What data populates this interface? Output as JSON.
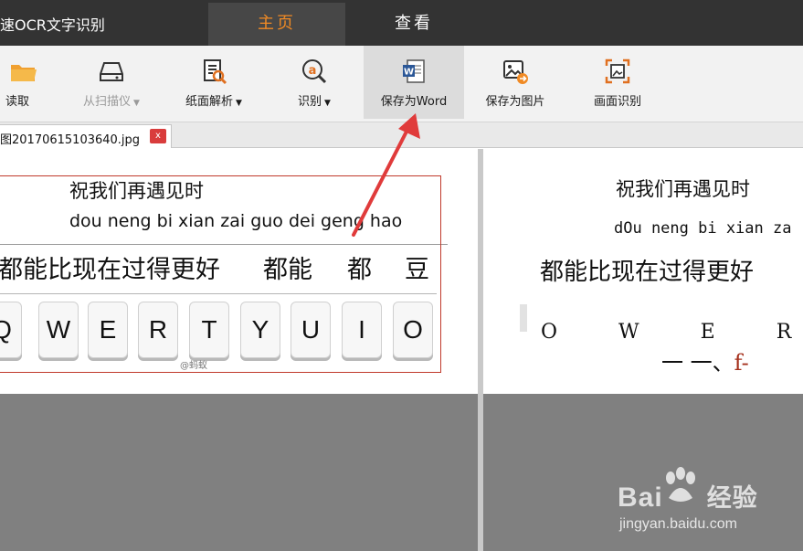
{
  "window": {
    "title": "速OCR文字识别"
  },
  "top_tabs": [
    {
      "label": "主页",
      "active": true
    },
    {
      "label": "查看",
      "active": false
    }
  ],
  "toolbar": {
    "items": [
      {
        "label": "读取",
        "icon": "folder-icon",
        "dropdown": false,
        "disabled": false
      },
      {
        "label": "从扫描仪",
        "icon": "scanner-icon",
        "dropdown": true,
        "disabled": true
      },
      {
        "label": "纸面解析",
        "icon": "page-analysis-icon",
        "dropdown": true,
        "disabled": false
      },
      {
        "label": "识别",
        "icon": "recognize-icon",
        "dropdown": true,
        "disabled": false
      },
      {
        "label": "保存为Word",
        "icon": "word-icon",
        "dropdown": false,
        "disabled": false,
        "highlighted": true
      },
      {
        "label": "保存为图片",
        "icon": "save-image-icon",
        "dropdown": false,
        "disabled": false
      },
      {
        "label": "画面识别",
        "icon": "screen-capture-icon",
        "dropdown": false,
        "disabled": false
      }
    ],
    "dropdown_glyph": "▼"
  },
  "file_tab": {
    "name": "图20170615103640.jpg",
    "close_label": "x"
  },
  "source_image": {
    "line1": "祝我们再遇见时",
    "line2": "dou neng bi xian zai guo dei geng hao",
    "line3": "都能比现在过得更好",
    "line3_words": [
      "都能",
      "都",
      "豆"
    ],
    "keys": [
      "Q",
      "W",
      "E",
      "R",
      "T",
      "Y",
      "U",
      "I",
      "O"
    ],
    "watermark": "@蚂蚁"
  },
  "ocr_result": {
    "line1": "祝我们再遇见时",
    "line2": "dOu neng bi xian za",
    "line3": "都能比现在过得更好",
    "keys_line": "O W E R T Y",
    "tail_dark": "一 一、",
    "tail_red": "f-"
  },
  "watermark": {
    "logo_text": "Bai",
    "logo_suffix": "经验",
    "url": "jingyan.baidu.com"
  },
  "colors": {
    "titlebar": "#333333",
    "active_tab_text": "#f08a24",
    "highlight_rect": "#c0392b",
    "arrow": "#e03b3b"
  }
}
